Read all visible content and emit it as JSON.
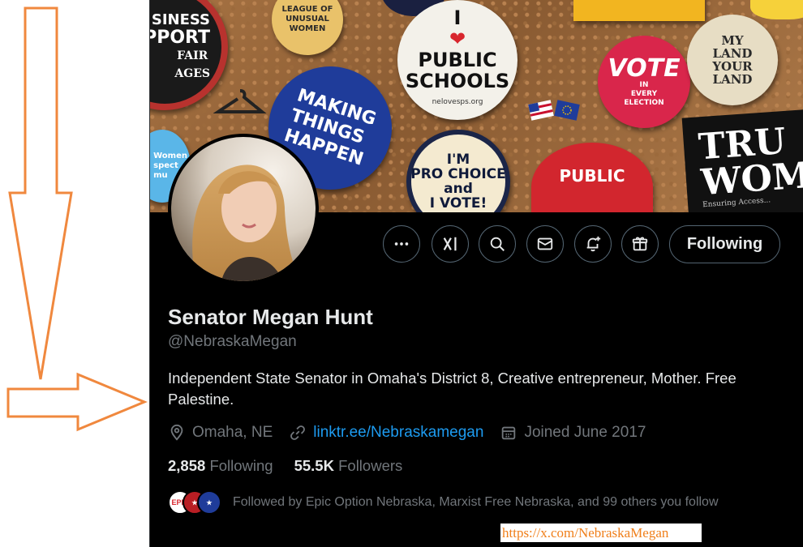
{
  "profile": {
    "display_name": "Senator Megan Hunt",
    "handle": "@NebraskaMegan",
    "bio": "Independent State Senator in Omaha's District 8, Creative entrepreneur, Mother. Free Palestine.",
    "location": "Omaha, NE",
    "link": "linktr.ee/Nebraskamegan",
    "joined": "Joined June 2017",
    "following_count": "2,858",
    "following_label": "Following",
    "followers_count": "55.5K",
    "followers_label": "Followers",
    "followed_by": "Followed by Epic Option Nebraska, Marxist Free Nebraska, and 99 others you follow"
  },
  "actions": {
    "following_button": "Following",
    "icons": [
      "more-icon",
      "grok-icon",
      "search-icon",
      "message-icon",
      "notification-add-icon",
      "gift-icon"
    ]
  },
  "banner": {
    "pins": {
      "business_support_top": "SINESS",
      "business_support_mid": "PPORT",
      "business_support_bottom": "FAIR\nAGES",
      "league": "LEAGUE OF\nUNUSUAL\nWOMEN",
      "making_things_happen": "MAKING\nTHINGS\nHAPPEN",
      "i_love_public_schools": "PUBLIC\nSCHOOLS",
      "i_love_prefix": "I",
      "public_schools_url": "nelovesps.org",
      "pro_choice": "I'M\nPRO CHOICE\nand\nI VOTE!",
      "vote": "VOTE",
      "vote_small": "IN\nEVERY\nELECTION",
      "my_land": "MY\nLAND\nYOUR\nLAND",
      "public": "PUBLIC",
      "women": "Women\nspect\nmu",
      "true_women": "TRU\nWOM",
      "true_women_small": "Ensuring Access..."
    }
  },
  "annotation": {
    "url_caption": "https://x.com/NebraskaMegan",
    "arrow_color": "#f0883e"
  },
  "colors": {
    "background": "#000000",
    "text_primary": "#e7e9ea",
    "text_secondary": "#71767b",
    "link": "#1d9bf0",
    "border": "#536471"
  }
}
